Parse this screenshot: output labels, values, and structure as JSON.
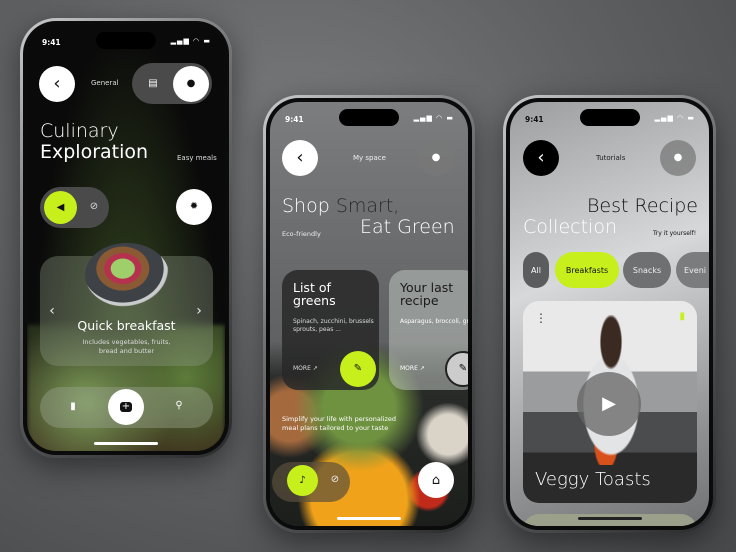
{
  "colors": {
    "accent": "#c6ef1c",
    "dark": "#111111"
  },
  "phone1": {
    "time": "9:41",
    "status": "▂▄▆ ◠ ▬",
    "header_label": "General",
    "title_line1": "Culinary",
    "title_line2": "Exploration",
    "tag": "Easy meals",
    "card": {
      "title": "Quick breakfast",
      "subtitle": "Includes vegetables, fruits, bread and butter"
    },
    "icons": {
      "back": "‹",
      "doc": "▤",
      "user": "●",
      "sound": "◀",
      "mute": "⊘",
      "settings": "✹",
      "prev": "‹",
      "next": "›",
      "bookmark": "▮",
      "add": "+",
      "search": "⚲"
    }
  },
  "phone2": {
    "time": "9:41",
    "status": "▂▄▆ ◠ ▬",
    "header_label": "My space",
    "title_part1": "Shop ",
    "title_part2": "Smart,",
    "title_line2": "Eat Green",
    "tag": "Eco-friendly",
    "cards": [
      {
        "title": "List of greens",
        "desc": "Spinach, zucchini, brussels sprouts, peas ...",
        "more": "MORE ↗"
      },
      {
        "title": "Your last recipe",
        "desc": "Asparagus, broccoli, green beans, cucumb",
        "more": "MORE ↗"
      }
    ],
    "tagline": "Simplify your life with personalized meal plans tailored to your taste",
    "icons": {
      "back": "‹",
      "user": "●",
      "edit": "✎",
      "bell": "♪",
      "bell_off": "⊘",
      "home": "⌂"
    }
  },
  "phone3": {
    "time": "9:41",
    "status": "▂▄▆ ◠ ▬",
    "header_label": "Tutorials",
    "title_line1": "Best Recipe",
    "title_line2": "Collection",
    "tag": "Try it yourself!",
    "chips": [
      {
        "label": "All",
        "active": false
      },
      {
        "label": "Breakfasts",
        "active": true
      },
      {
        "label": "Snacks",
        "active": false
      },
      {
        "label": "Eveni",
        "active": false
      }
    ],
    "video": {
      "title": "Veggy Toasts"
    },
    "icons": {
      "back": "‹",
      "user": "●",
      "menu": "⋮",
      "bookmark": "▮",
      "play": "▶"
    }
  }
}
